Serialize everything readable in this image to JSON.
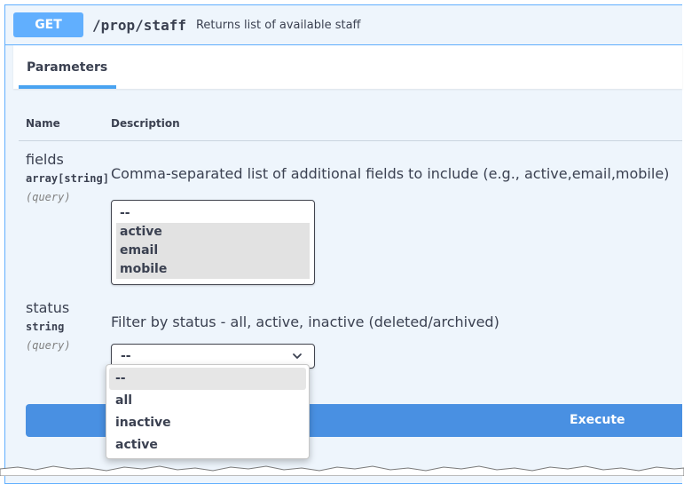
{
  "operation": {
    "method": "GET",
    "path": "/prop/staff",
    "summary": "Returns list of available staff"
  },
  "section": {
    "tab_label": "Parameters"
  },
  "table_headers": {
    "name": "Name",
    "description": "Description"
  },
  "params": [
    {
      "name": "fields",
      "type": "array[string]",
      "in": "(query)",
      "description": "Comma-separated list of additional fields to include (e.g., active,email,mobile)",
      "options": [
        "--",
        "active",
        "email",
        "mobile"
      ],
      "selected": [
        "active",
        "email",
        "mobile"
      ]
    },
    {
      "name": "status",
      "type": "string",
      "in": "(query)",
      "description": "Filter by status - all, active, inactive (deleted/archived)",
      "value": "--",
      "options": [
        "--",
        "all",
        "inactive",
        "active"
      ],
      "highlighted": "--"
    }
  ],
  "execute_label": "Execute",
  "colors": {
    "accent": "#61affe",
    "execute": "#4990e2",
    "background": "#eef5fc"
  }
}
